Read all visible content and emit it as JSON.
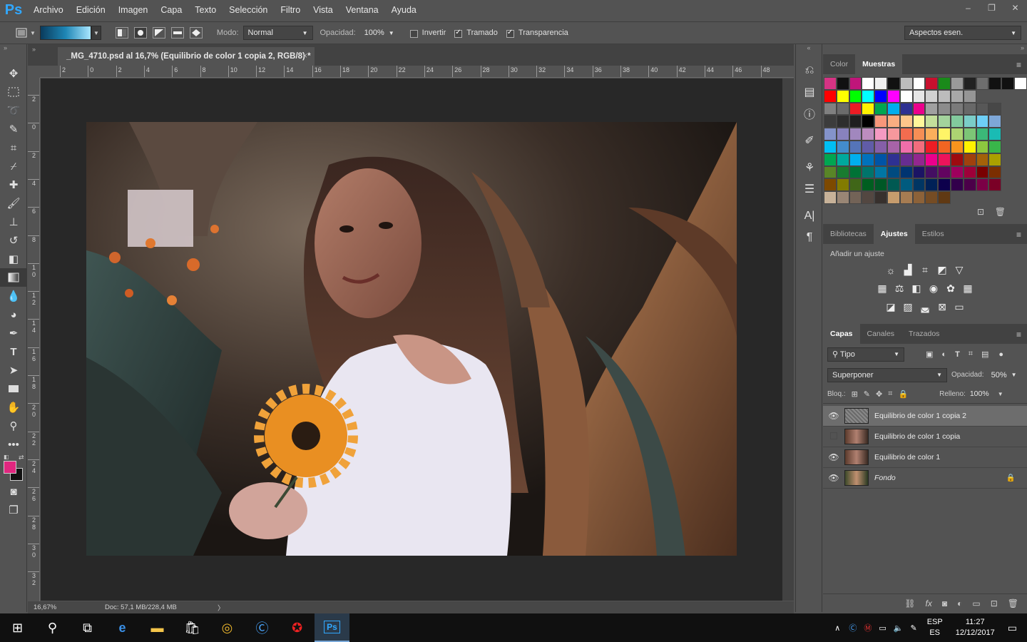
{
  "app": {
    "logo": "Ps"
  },
  "menu": [
    "Archivo",
    "Edición",
    "Imagen",
    "Capa",
    "Texto",
    "Selección",
    "Filtro",
    "Vista",
    "Ventana",
    "Ayuda"
  ],
  "window_controls": [
    "–",
    "❐",
    "✕"
  ],
  "options": {
    "mode_label": "Modo:",
    "mode_value": "Normal",
    "opacity_label": "Opacidad:",
    "opacity_value": "100%",
    "invert_label": "Invertir",
    "dither_label": "Tramado",
    "transparency_label": "Transparencia",
    "workspace": "Aspectos esen."
  },
  "document": {
    "tab_title": "_MG_4710.psd al 16,7% (Equilibrio de color 1 copia 2, RGB/8) *",
    "tab_close": "×",
    "ruler_h": [
      "2",
      "0",
      "2",
      "4",
      "6",
      "8",
      "10",
      "12",
      "14",
      "16",
      "18",
      "20",
      "22",
      "24",
      "26",
      "28",
      "30",
      "32",
      "34",
      "36",
      "38",
      "40",
      "42",
      "44",
      "46",
      "48"
    ],
    "ruler_v": [
      "2",
      "0",
      "2",
      "4",
      "6",
      "8",
      "1 0",
      "1 2",
      "1 4",
      "1 6",
      "1 8",
      "2 0",
      "2 2",
      "2 4",
      "2 6",
      "2 8",
      "3 0",
      "3 2"
    ],
    "zoom": "16,67%",
    "doc_info": "Doc: 57,1 MB/228,4 MB",
    "status_arrow": "〉"
  },
  "colors": {
    "foreground": "#e0277f",
    "background": "#111111"
  },
  "panels": {
    "color_tabs": [
      "Color",
      "Muestras"
    ],
    "adj_tabs": [
      "Bibliotecas",
      "Ajustes",
      "Estilos"
    ],
    "adj_title": "Añadir un ajuste",
    "layer_tabs": [
      "Capas",
      "Canales",
      "Trazados"
    ],
    "layer_filter": "Tipo",
    "blend_mode": "Superponer",
    "opacity_label": "Opacidad:",
    "opacity_value": "50%",
    "lock_label": "Bloq.:",
    "fill_label": "Relleno:",
    "fill_value": "100%",
    "layers": [
      {
        "name": "Equilibrio de color 1 copia 2",
        "visible": true,
        "selected": true
      },
      {
        "name": "Equilibrio de color 1 copia",
        "visible": false,
        "selected": false
      },
      {
        "name": "Equilibrio de color 1",
        "visible": true,
        "selected": false
      },
      {
        "name": "Fondo",
        "visible": true,
        "selected": false,
        "locked": true
      }
    ]
  },
  "swatches": [
    [
      "#d63384",
      "#111111",
      "#c0157a",
      "#ffffff",
      "#f0f0f0",
      "#111111",
      "#bdbdbd",
      "#ffffff",
      "#c8102e",
      "#1a8a1a",
      "#9a9a9a",
      "#222222",
      "#6e6e6e",
      "#111111",
      "#111111",
      "#ffffff"
    ],
    [
      "#ff0000",
      "#ffff00",
      "#00ff00",
      "#00ffff",
      "#0000ff",
      "#ff00ff",
      "#ffffff",
      "#e6e6e6",
      "#d1d1d1",
      "#bcbcbc",
      "#a8a8a8",
      "#959595"
    ],
    [
      "#808080",
      "#6b6b6b",
      "#ed1c24",
      "#fff200",
      "#00a651",
      "#00aeef",
      "#2e3192",
      "#ec008c",
      "#a0a0a0",
      "#8c8c8c",
      "#7a7a7a",
      "#686868",
      "#575757",
      "#474747"
    ],
    [
      "#3c3c3c",
      "#2e2e2e",
      "#1f1f1f",
      "#000000",
      "#f7977a",
      "#f9ad81",
      "#fdc68a",
      "#fff79a",
      "#c4df9b",
      "#a3d39c",
      "#82ca9d",
      "#7bcdc8",
      "#6ecff6",
      "#7ea7d8"
    ],
    [
      "#8493ca",
      "#8882be",
      "#a187be",
      "#bc8dbf",
      "#f49ac2",
      "#f6989d",
      "#f26c4f",
      "#f68e55",
      "#fbaf5c",
      "#fff467",
      "#acd372",
      "#7cc576",
      "#3bb878",
      "#1abbb4"
    ],
    [
      "#00bff3",
      "#438ccb",
      "#5574b9",
      "#605ca8",
      "#855fa8",
      "#a763a8",
      "#f06eaa",
      "#f26d7d",
      "#ed1c24",
      "#f26522",
      "#f7941d",
      "#fff200",
      "#8dc73f",
      "#39b54a"
    ],
    [
      "#00a651",
      "#00a99d",
      "#00aeef",
      "#0072bc",
      "#0054a6",
      "#2e3192",
      "#662d91",
      "#92278f",
      "#ec008c",
      "#ed145b",
      "#9e0b0f",
      "#a0410d",
      "#a36209",
      "#aba000"
    ],
    [
      "#598527",
      "#197b30",
      "#007236",
      "#00746b",
      "#0076a3",
      "#004b80",
      "#003471",
      "#1b1464",
      "#440e62",
      "#630460",
      "#9e005d",
      "#9e0039",
      "#790000",
      "#7b2e00"
    ],
    [
      "#7d4900",
      "#827b00",
      "#406618",
      "#005e20",
      "#005826",
      "#005952",
      "#005b7f",
      "#003663",
      "#002157",
      "#0d004c",
      "#32004b",
      "#4b0049",
      "#7b0046",
      "#7a0026"
    ],
    [
      "#c7b299",
      "#998675",
      "#736357",
      "#534741",
      "#37302d",
      "#c69c6d",
      "#a67c52",
      "#8c6239",
      "#754c24",
      "#603913"
    ]
  ]
}
